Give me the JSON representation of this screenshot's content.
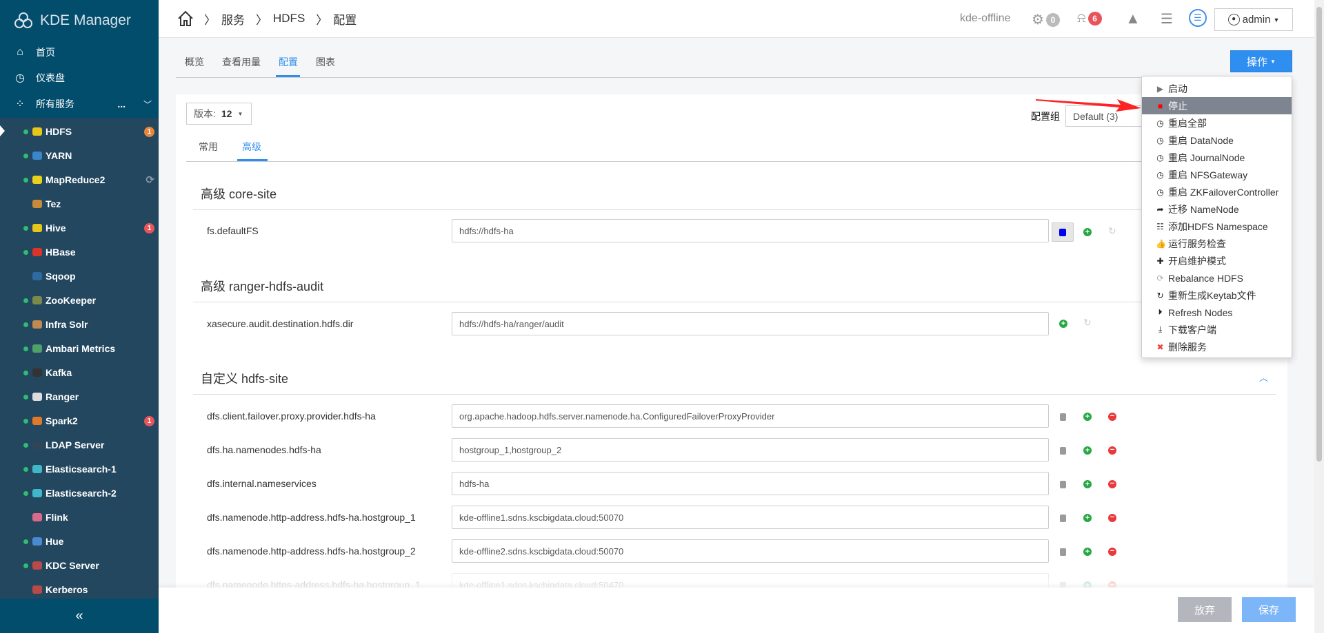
{
  "sidebar": {
    "app_title": "KDE Manager",
    "nav": [
      {
        "label": "首页",
        "icon": "home-icon"
      },
      {
        "label": "仪表盘",
        "icon": "clock-icon"
      },
      {
        "label": "所有服务",
        "icon": "grid-icon"
      }
    ],
    "services_more": "...",
    "services": [
      {
        "name": "HDFS",
        "status": true,
        "badge": "1",
        "badge_color": "#e8873a",
        "icon_color": "#e6c619"
      },
      {
        "name": "YARN",
        "status": true,
        "icon_color": "#3a86c8"
      },
      {
        "name": "MapReduce2",
        "status": true,
        "icon_color": "#e6d21a",
        "refresh": true
      },
      {
        "name": "Tez",
        "status": false,
        "icon_color": "#c98a3a"
      },
      {
        "name": "Hive",
        "status": true,
        "badge": "1",
        "badge_color": "#e9545a",
        "icon_color": "#e6c619"
      },
      {
        "name": "HBase",
        "status": true,
        "icon_color": "#d9332a"
      },
      {
        "name": "Sqoop",
        "status": false,
        "icon_color": "#2c6aa0"
      },
      {
        "name": "ZooKeeper",
        "status": true,
        "icon_color": "#7a8a4a"
      },
      {
        "name": "Infra Solr",
        "status": true,
        "icon_color": "#c08a50"
      },
      {
        "name": "Ambari Metrics",
        "status": true,
        "icon_color": "#4fa06a"
      },
      {
        "name": "Kafka",
        "status": true,
        "icon_color": "#333333"
      },
      {
        "name": "Ranger",
        "status": true,
        "icon_color": "#dddddd"
      },
      {
        "name": "Spark2",
        "status": true,
        "badge": "1",
        "badge_color": "#e9545a",
        "icon_color": "#e07a2a"
      },
      {
        "name": "LDAP Server",
        "status": true,
        "icon_color": "#2f4558"
      },
      {
        "name": "Elasticsearch-1",
        "status": true,
        "icon_color": "#3fb7c8"
      },
      {
        "name": "Elasticsearch-2",
        "status": true,
        "icon_color": "#3fb7c8"
      },
      {
        "name": "Flink",
        "status": false,
        "icon_color": "#d96a8a"
      },
      {
        "name": "Hue",
        "status": true,
        "icon_color": "#4a8ad0"
      },
      {
        "name": "KDC Server",
        "status": true,
        "icon_color": "#b84a4a"
      },
      {
        "name": "Kerberos",
        "status": false,
        "icon_color": "#b84a4a"
      }
    ],
    "collapse_label": "«"
  },
  "header": {
    "breadcrumb": [
      "服务",
      "HDFS",
      "配置"
    ],
    "cluster": "kde-offline",
    "ops_count": "0",
    "alerts_count": "6",
    "user": "admin"
  },
  "tabs": [
    {
      "label": "概览"
    },
    {
      "label": "查看用量"
    },
    {
      "label": "配置",
      "active": true
    },
    {
      "label": "图表"
    }
  ],
  "actions_button": "操作",
  "version": {
    "label": "版本:",
    "value": "12"
  },
  "config_group": {
    "label": "配置组",
    "value": "Default (3)"
  },
  "subtabs": [
    {
      "label": "常用"
    },
    {
      "label": "高级",
      "active": true
    }
  ],
  "sections": [
    {
      "title": "高级 core-site",
      "rows": [
        {
          "key": "fs.defaultFS",
          "value": "hdfs://hdfs-ha"
        }
      ]
    },
    {
      "title": "高级 ranger-hdfs-audit",
      "rows": [
        {
          "key": "xasecure.audit.destination.hdfs.dir",
          "value": "hdfs://hdfs-ha/ranger/audit"
        }
      ]
    },
    {
      "title": "自定义 hdfs-site",
      "rows": [
        {
          "key": "dfs.client.failover.proxy.provider.hdfs-ha",
          "value": "org.apache.hadoop.hdfs.server.namenode.ha.ConfiguredFailoverProxyProvider"
        },
        {
          "key": "dfs.ha.namenodes.hdfs-ha",
          "value": "hostgroup_1,hostgroup_2"
        },
        {
          "key": "dfs.internal.nameservices",
          "value": "hdfs-ha"
        },
        {
          "key": "dfs.namenode.http-address.hdfs-ha.hostgroup_1",
          "value": "kde-offline1.sdns.kscbigdata.cloud:50070"
        },
        {
          "key": "dfs.namenode.http-address.hdfs-ha.hostgroup_2",
          "value": "kde-offline2.sdns.kscbigdata.cloud:50070"
        },
        {
          "key": "dfs.namenode.https-address.hdfs-ha.hostgroup_1",
          "value": "kde-offline1.sdns.kscbigdata.cloud:50470"
        }
      ]
    }
  ],
  "actions_menu": [
    {
      "label": "启动",
      "icon": "play-icon",
      "glyph": "▶",
      "color": "#777777"
    },
    {
      "label": "停止",
      "icon": "stop-icon",
      "glyph": "■",
      "color": "#ff0000",
      "highlighted": true
    },
    {
      "label": "重启全部",
      "icon": "clock-icon",
      "glyph": "◷",
      "color": "#222222"
    },
    {
      "label": "重启 DataNode",
      "icon": "clock-icon",
      "glyph": "◷",
      "color": "#222222"
    },
    {
      "label": "重启 JournalNode",
      "icon": "clock-icon",
      "glyph": "◷",
      "color": "#222222"
    },
    {
      "label": "重启 NFSGateway",
      "icon": "clock-icon",
      "glyph": "◷",
      "color": "#222222"
    },
    {
      "label": "重启 ZKFailoverController",
      "icon": "clock-icon",
      "glyph": "◷",
      "color": "#222222"
    },
    {
      "label": "迁移 NameNode",
      "icon": "share-arrow-icon",
      "glyph": "➦",
      "color": "#222222"
    },
    {
      "label": "添加HDFS Namespace",
      "icon": "sitemap-icon",
      "glyph": "☷",
      "color": "#222222"
    },
    {
      "label": "运行服务检查",
      "icon": "thumbs-up-icon",
      "glyph": "👍",
      "color": "#222222"
    },
    {
      "label": "开启维护模式",
      "icon": "medkit-icon",
      "glyph": "✚",
      "color": "#222222"
    },
    {
      "label": "Rebalance HDFS",
      "icon": "refresh-icon",
      "glyph": "⟳",
      "color": "#aaaaaa"
    },
    {
      "label": "重新生成Keytab文件",
      "icon": "rotate-icon",
      "glyph": "↻",
      "color": "#222222"
    },
    {
      "label": "Refresh Nodes",
      "icon": "play-circle-icon",
      "glyph": "⏵",
      "color": "#222222"
    },
    {
      "label": "下载客户端",
      "icon": "download-icon",
      "glyph": "⤓",
      "color": "#222222"
    },
    {
      "label": "删除服务",
      "icon": "close-icon",
      "glyph": "✖",
      "color": "#ee4444"
    }
  ],
  "footer": {
    "discard": "放弃",
    "save": "保存"
  },
  "colors": {
    "accent": "#2f8ff0",
    "sidebar_top": "#034d6c",
    "sidebar": "#23475f",
    "annotation_arrow": "#ff2222"
  }
}
